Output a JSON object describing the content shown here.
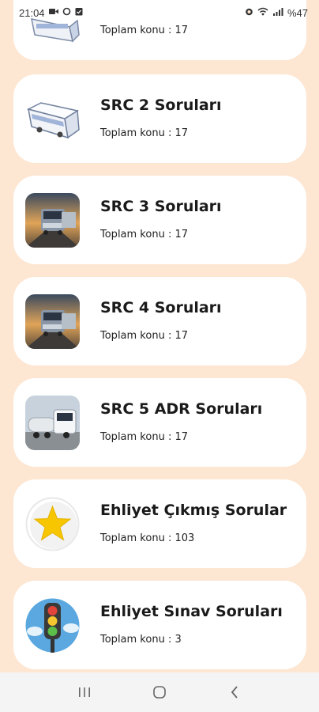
{
  "status_bar": {
    "time": "21:04",
    "battery": "%47",
    "left_icons": [
      "video-icon",
      "sync-icon",
      "clipboard-icon"
    ],
    "right_icons": [
      "alarm-icon",
      "wifi-icon",
      "signal-icon"
    ]
  },
  "items": [
    {
      "title": "",
      "subtitle": "Toplam konu : 17",
      "icon": "bus-icon"
    },
    {
      "title": "SRC 2 Soruları",
      "subtitle": "Toplam konu : 17",
      "icon": "bus-icon"
    },
    {
      "title": "SRC 3 Soruları",
      "subtitle": "Toplam konu : 17",
      "icon": "truck-photo-icon"
    },
    {
      "title": "SRC 4 Soruları",
      "subtitle": "Toplam konu : 17",
      "icon": "truck-photo-icon"
    },
    {
      "title": "SRC 5 ADR Soruları",
      "subtitle": "Toplam konu : 17",
      "icon": "tanker-truck-icon"
    },
    {
      "title": "Ehliyet Çıkmış Sorular",
      "subtitle": "Toplam konu : 103",
      "icon": "star-icon"
    },
    {
      "title": "Ehliyet Sınav Soruları",
      "subtitle": "Toplam konu : 3",
      "icon": "traffic-light-icon"
    }
  ],
  "nav_bar": {
    "buttons": [
      "recents-icon",
      "home-icon",
      "back-icon"
    ]
  },
  "colors": {
    "background": "#fde6d2",
    "card": "#ffffff",
    "star": "#f7c600",
    "nav": "#f5f4f4"
  }
}
